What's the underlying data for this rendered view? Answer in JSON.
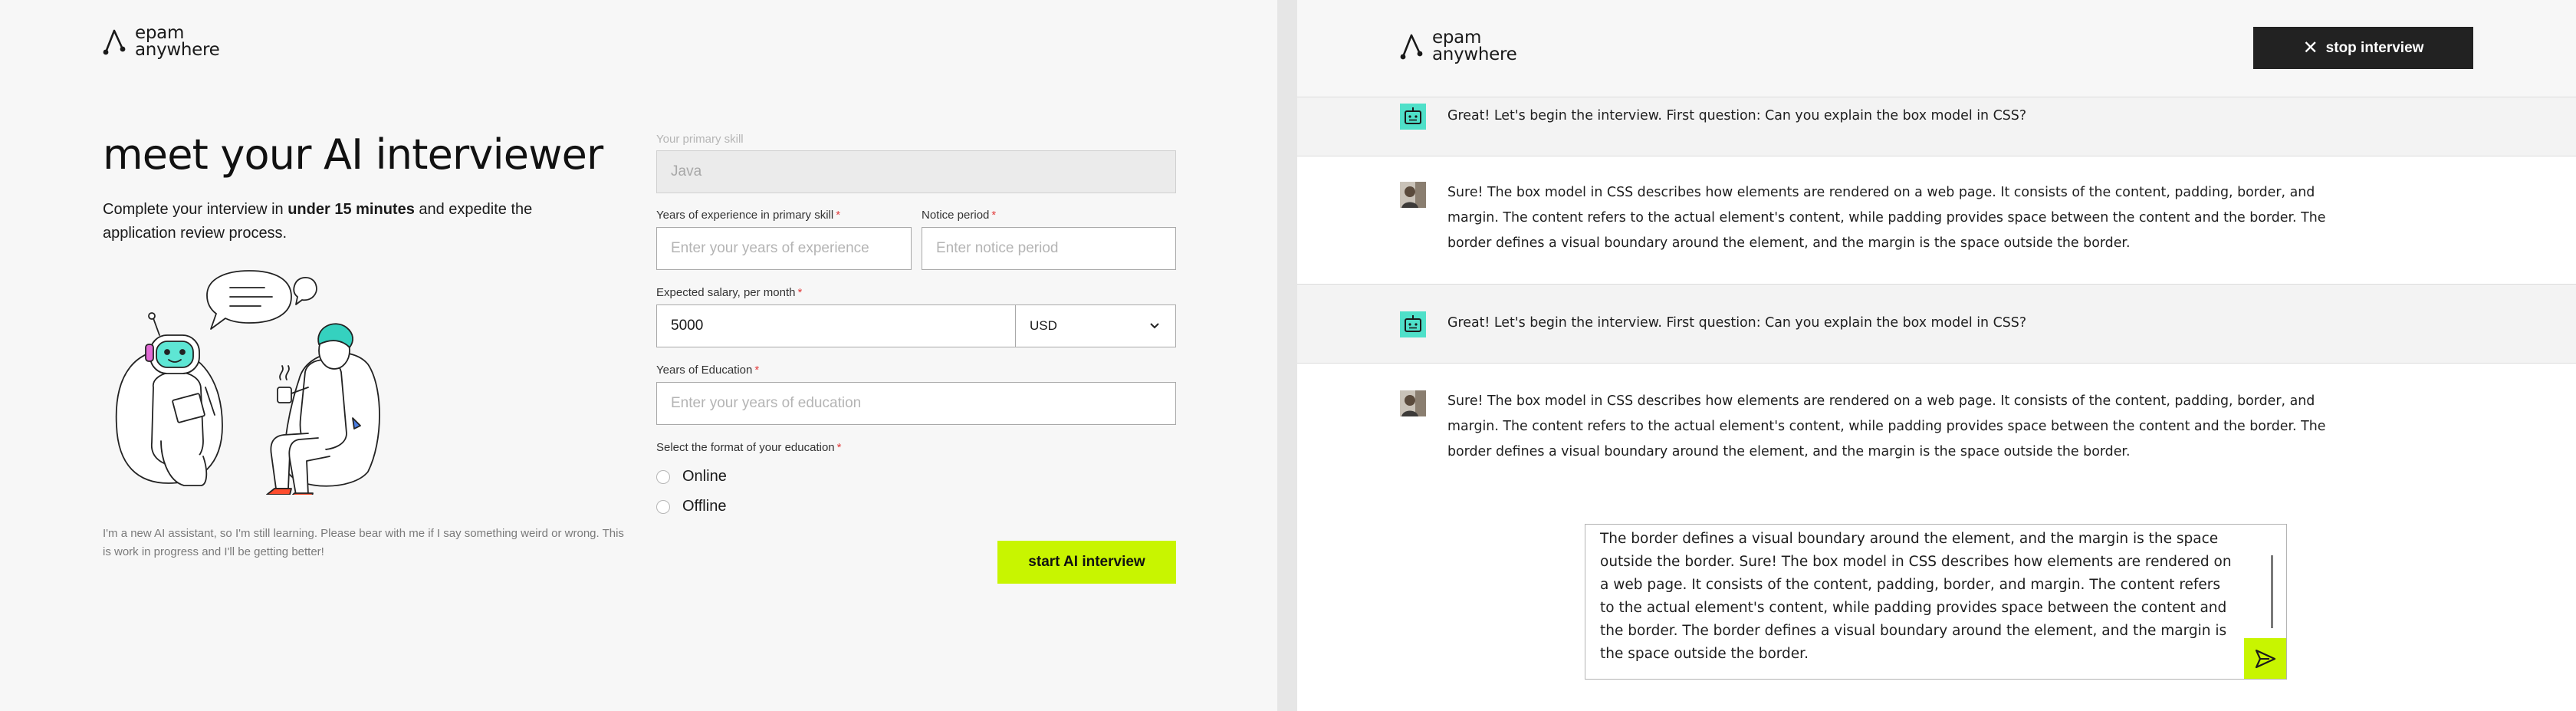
{
  "brand": {
    "line1": "epam",
    "line2": "anywhere",
    "accent_color": "#c8f500"
  },
  "left": {
    "title": "meet your AI interviewer",
    "description_prefix": "Complete your interview in ",
    "description_bold": "under 15 minutes",
    "description_suffix": " and expedite the application review process.",
    "disclaimer": "I'm a new AI assistant, so I'm still learning. Please bear with me if I say something weird or wrong. This is work in progress and I'll be getting better!",
    "form": {
      "primary_skill": {
        "label": "Your primary skill",
        "value": "Java"
      },
      "experience": {
        "label": "Years of experience in primary skill",
        "placeholder": "Enter your years of experience"
      },
      "notice": {
        "label": "Notice period",
        "placeholder": "Enter notice period"
      },
      "salary": {
        "label": "Expected salary, per month",
        "value": "5000",
        "currency": "USD"
      },
      "education": {
        "label": "Years of Education",
        "placeholder": "Enter your years of education"
      },
      "format": {
        "label": "Select the format of your education",
        "options": [
          "Online",
          "Offline"
        ]
      },
      "required_mark": "*",
      "submit_label": "start AI interview"
    }
  },
  "right": {
    "stop_label": "stop interview",
    "messages": [
      {
        "role": "bot",
        "text": "Great! Let's begin the interview. First question: Can you explain the box model in CSS?"
      },
      {
        "role": "user",
        "text": "Sure! The box model in CSS describes how elements are rendered on a web page. It consists of the content, padding, border, and margin. The content refers to the actual element's content, while padding provides space between the content and the border. The border defines a visual boundary around the element, and the margin is the space outside the border."
      },
      {
        "role": "bot",
        "text": "Great! Let's begin the interview. First question: Can you explain the box model in CSS?"
      },
      {
        "role": "user",
        "text": "Sure! The box model in CSS describes how elements are rendered on a web page. It consists of the content, padding, border, and margin. The content refers to the actual element's content, while padding provides space between the content and the border. The border defines a visual boundary around the element, and the margin is the space outside the border."
      }
    ],
    "composer_text": "The border defines a visual boundary around the element, and the margin is the space outside the border. Sure! The box model in CSS describes how elements are rendered on a web page. It consists of the content, padding, border, and margin. The content refers to the actual element's content, while padding provides space between the content and the border. The border defines a visual boundary around the element, and the margin is the space outside the border."
  }
}
